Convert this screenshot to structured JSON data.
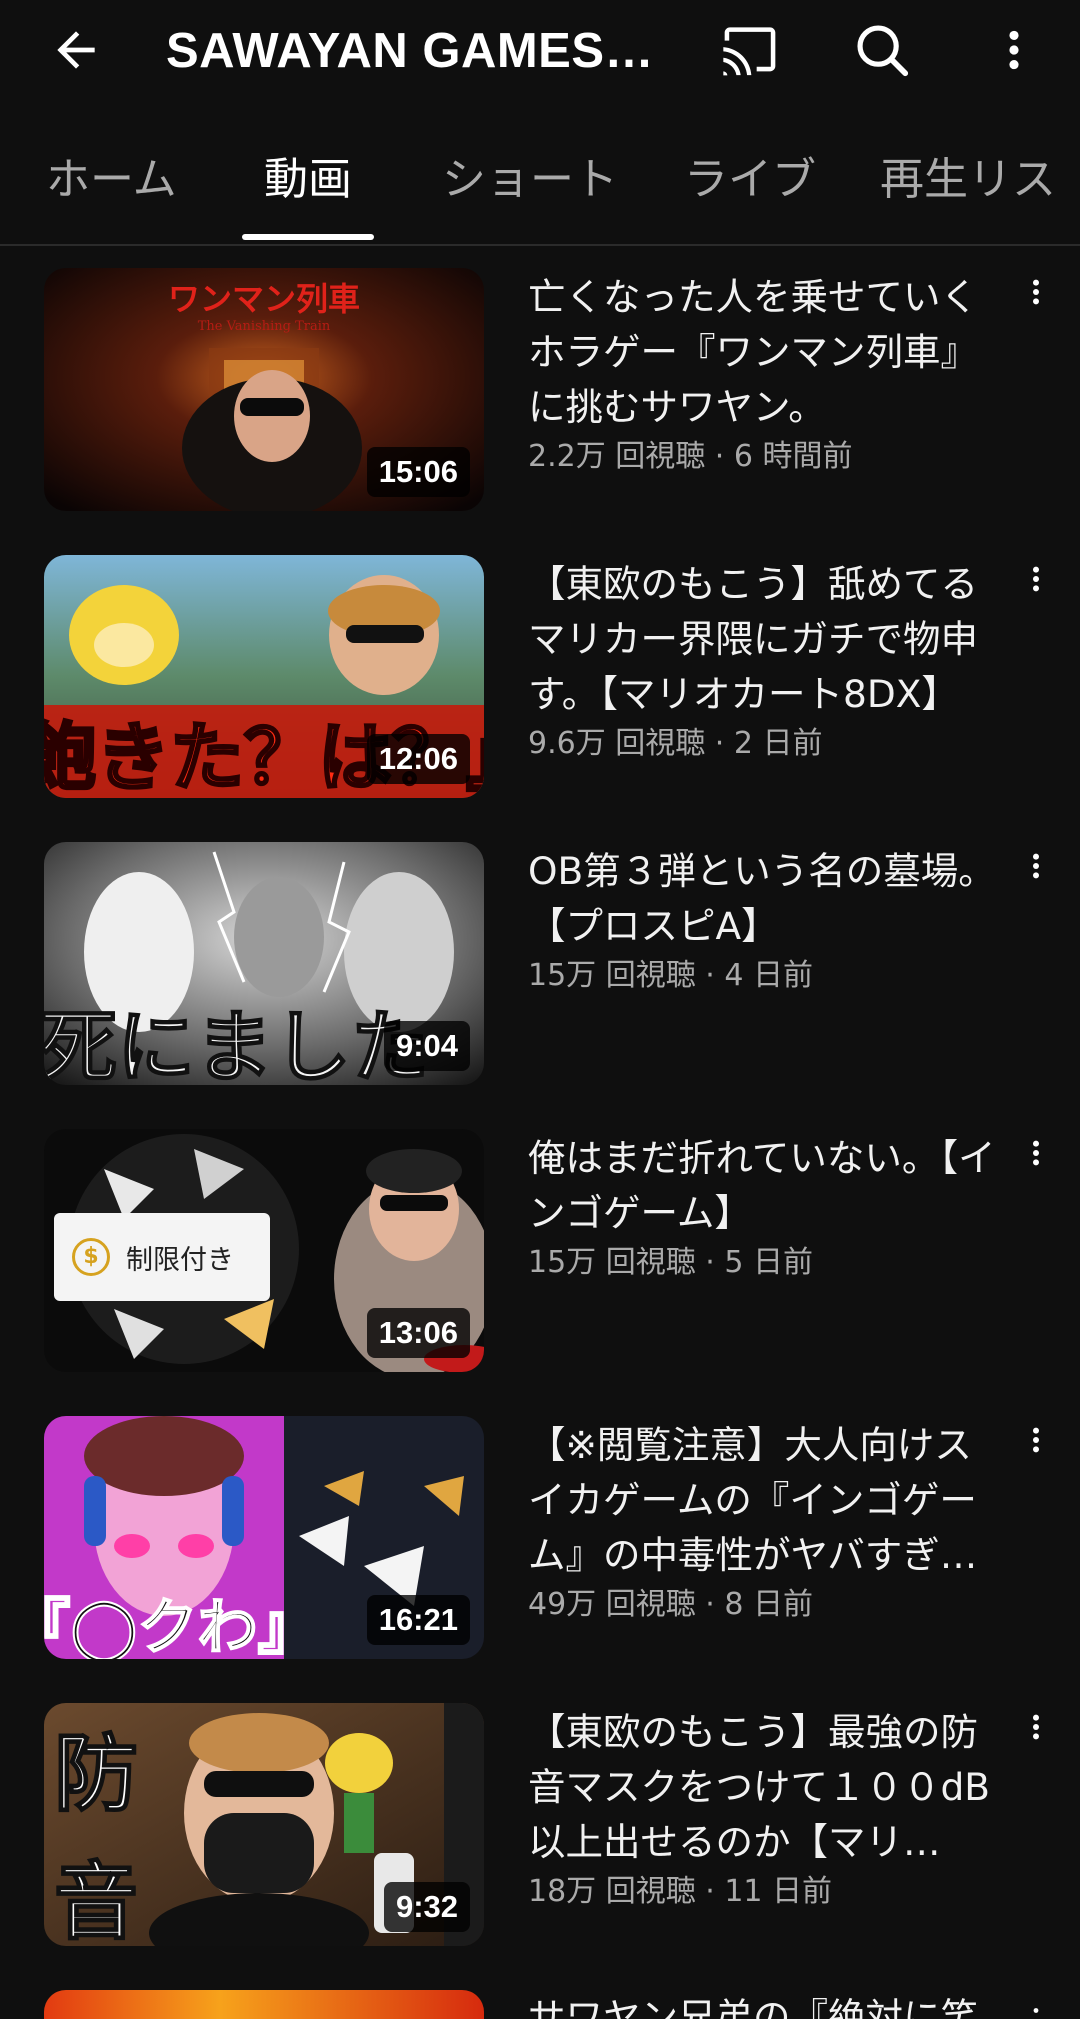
{
  "header": {
    "channel_title": "SAWAYAN GAMES…",
    "back_icon": "back-arrow-icon",
    "cast_icon": "cast-icon",
    "search_icon": "search-icon",
    "more_icon": "more-vert-icon"
  },
  "tabs": [
    {
      "label": "ホーム",
      "active": false
    },
    {
      "label": "動画",
      "active": true
    },
    {
      "label": "ショート",
      "active": false
    },
    {
      "label": "ライブ",
      "active": false
    },
    {
      "label": "再生リス",
      "active": false
    }
  ],
  "videos": [
    {
      "title": "亡くなった人を乗せていくホラゲー『ワンマン列車』に挑むサワヤン。",
      "meta": "2.2万 回視聴 · 6 時間前",
      "duration": "15:06",
      "thumb_text": "ワンマン列車",
      "thumb_subtext": "The Vanishing Train"
    },
    {
      "title": "【東欧のもこう】舐めてるマリカー界隈にガチで物申す。【マリオカート8DX】",
      "meta": "9.6万 回視聴 · 2 日前",
      "duration": "12:06",
      "thumb_text": "『飽きた？は？』"
    },
    {
      "title": "OB第３弾という名の墓場。【プロスピA】",
      "meta": "15万 回視聴 · 4 日前",
      "duration": "9:04",
      "thumb_text": "死にました"
    },
    {
      "title": "俺はまだ折れていない。【インゴゲーム】",
      "meta": "15万 回視聴 · 5 日前",
      "duration": "13:06",
      "restricted_label": "制限付き",
      "restricted_icon": "coin-icon"
    },
    {
      "title": "【※閲覧注意】大人向けスイカゲームの『インゴゲーム』の中毒性がヤバすぎ…",
      "meta": "49万 回視聴 · 8 日前",
      "duration": "16:21",
      "thumb_text": "『◯クわ』"
    },
    {
      "title": "【東欧のもこう】最強の防音マスクをつけて１００dB以上出せるのか【マリ…",
      "meta": "18万 回視聴 · 11 日前",
      "duration": "9:32",
      "thumb_text": "防音"
    }
  ],
  "partial_video": {
    "title": "サワヤン兄弟の『絶対に笑"
  },
  "colors": {
    "background": "#0f0f0f",
    "text_primary": "#f1f1f1",
    "text_secondary": "#aaaaaa",
    "tab_indicator": "#ffffff"
  }
}
